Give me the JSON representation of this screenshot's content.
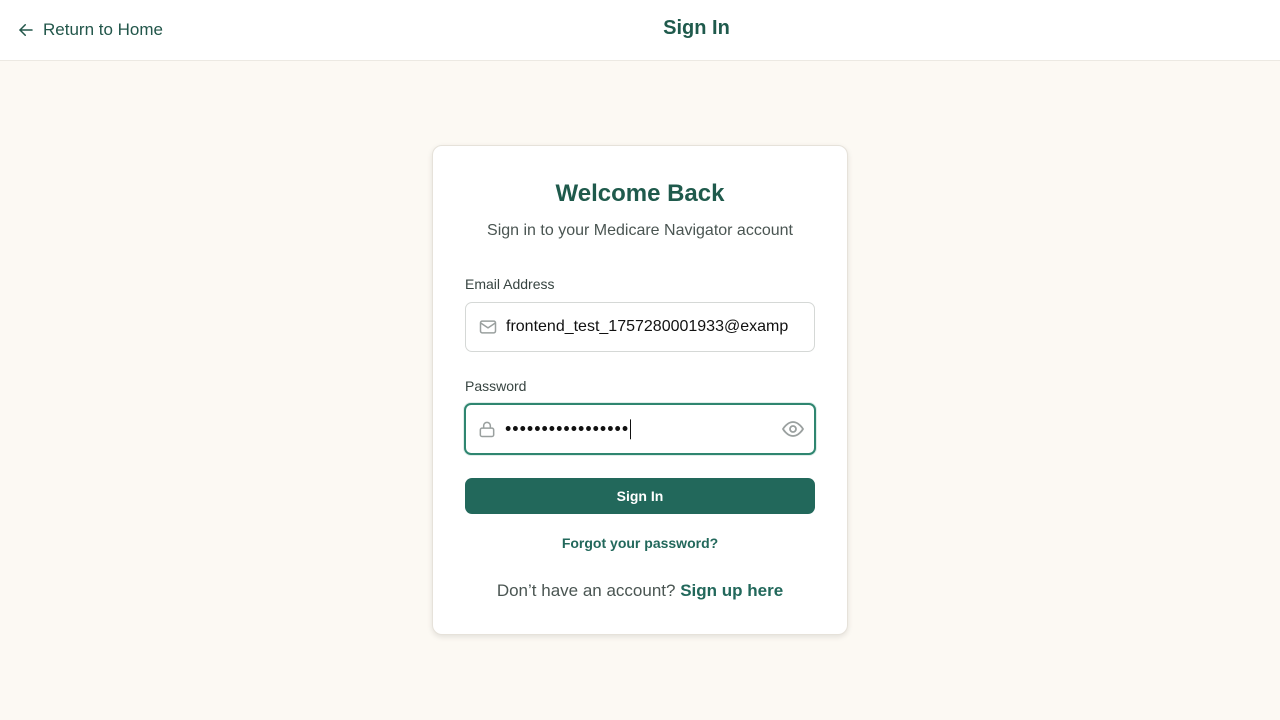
{
  "header": {
    "back_label": "Return to Home",
    "title": "Sign In"
  },
  "card": {
    "heading": "Welcome Back",
    "subtitle": "Sign in to your Medicare Navigator account",
    "email": {
      "label": "Email Address",
      "value": "frontend_test_1757280001933@examp",
      "icon": "mail-icon"
    },
    "password": {
      "label": "Password",
      "masked_value": "•••••••••••••••••",
      "icon": "lock-icon",
      "toggle_icon": "eye-icon"
    },
    "submit_label": "Sign In",
    "forgot_label": "Forgot your password?",
    "signup_prompt": "Don’t have an account?",
    "signup_link": "Sign up here"
  },
  "colors": {
    "brand": "#22685b",
    "heading": "#1f5a4c",
    "background": "#fcf9f3",
    "focus_border": "#2f8670"
  }
}
